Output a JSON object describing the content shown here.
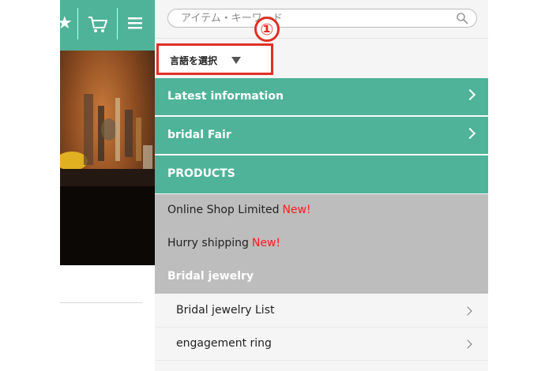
{
  "header": {
    "star_icon": "star-icon",
    "cart_icon": "cart-icon",
    "menu_icon": "hamburger-menu-icon"
  },
  "search": {
    "placeholder": "アイテム・キーワード",
    "icon": "search-icon"
  },
  "language": {
    "label": "言語を選択",
    "annotation_number": "①",
    "highlight_color": "#e03024"
  },
  "menu": {
    "accent_color": "#4fb399",
    "sections": [
      {
        "label": "Latest information"
      },
      {
        "label": "bridal Fair"
      },
      {
        "label": "PRODUCTS"
      }
    ],
    "products": [
      {
        "label": "Online Shop Limited",
        "badge": "New!"
      },
      {
        "label": "Hurry shipping",
        "badge": "New!"
      }
    ],
    "bridal_heading": "Bridal jewelry",
    "bridal_items": [
      {
        "label": "Bridal jewelry List"
      },
      {
        "label": "engagement ring"
      }
    ]
  }
}
